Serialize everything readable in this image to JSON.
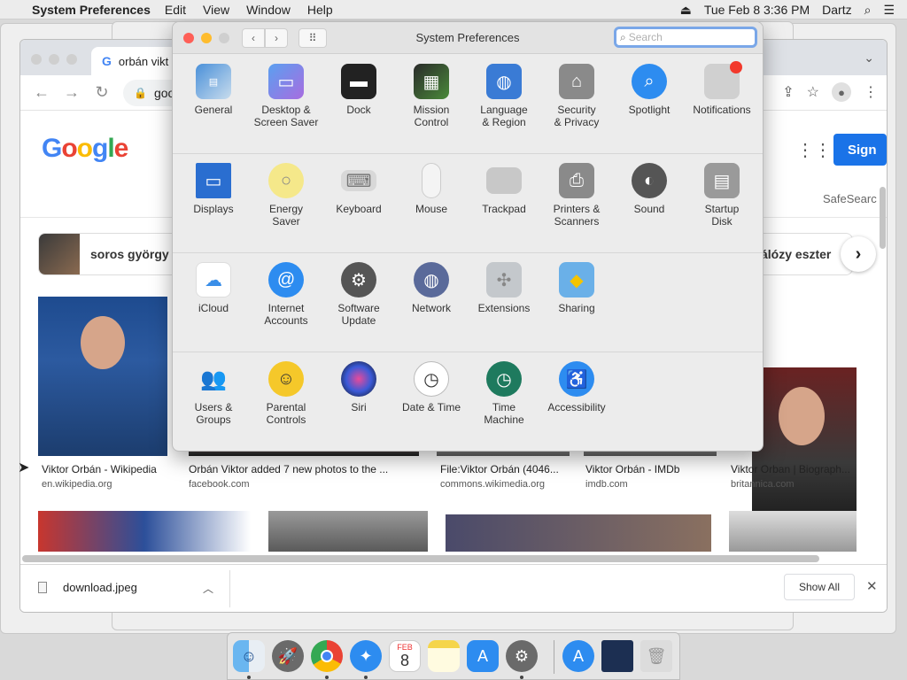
{
  "menubar": {
    "app": "System Preferences",
    "items": [
      "Edit",
      "View",
      "Window",
      "Help"
    ],
    "datetime": "Tue Feb 8  3:36 PM",
    "user": "Dartz"
  },
  "chrome": {
    "tab_title": "orbán vikt",
    "url": "goog",
    "google_logo": "Google",
    "signin": "Sign",
    "safesearch": "SafeSearc",
    "chips": [
      "soros györgy",
      "álózy eszter"
    ],
    "results": [
      {
        "title": "Viktor Orbán - Wikipedia",
        "source": "en.wikipedia.org"
      },
      {
        "title": "Orbán Viktor added 7 new photos to the ...",
        "source": "facebook.com"
      },
      {
        "title": "File:Viktor Orbán (4046...",
        "source": "commons.wikimedia.org"
      },
      {
        "title": "Viktor Orbán - IMDb",
        "source": "imdb.com"
      },
      {
        "title": "Viktor Orban | Biograph...",
        "source": "britannica.com"
      }
    ],
    "download": {
      "filename": "download.jpeg",
      "show_all": "Show All"
    }
  },
  "syspref": {
    "title": "System Preferences",
    "search_placeholder": "Search",
    "rows": [
      [
        {
          "label": "General",
          "icon": "general-icon"
        },
        {
          "label": "Desktop &\nScreen Saver",
          "icon": "desktop-icon"
        },
        {
          "label": "Dock",
          "icon": "dock-icon"
        },
        {
          "label": "Mission\nControl",
          "icon": "mission-control-icon"
        },
        {
          "label": "Language\n& Region",
          "icon": "globe-icon"
        },
        {
          "label": "Security\n& Privacy",
          "icon": "house-lock-icon"
        },
        {
          "label": "Spotlight",
          "icon": "magnifier-icon"
        },
        {
          "label": "Notifications",
          "icon": "notifications-icon"
        }
      ],
      [
        {
          "label": "Displays",
          "icon": "display-icon"
        },
        {
          "label": "Energy\nSaver",
          "icon": "bulb-icon"
        },
        {
          "label": "Keyboard",
          "icon": "keyboard-icon"
        },
        {
          "label": "Mouse",
          "icon": "mouse-icon"
        },
        {
          "label": "Trackpad",
          "icon": "trackpad-icon"
        },
        {
          "label": "Printers &\nScanners",
          "icon": "printer-icon"
        },
        {
          "label": "Sound",
          "icon": "speaker-icon"
        },
        {
          "label": "Startup\nDisk",
          "icon": "disk-icon"
        }
      ],
      [
        {
          "label": "iCloud",
          "icon": "cloud-icon"
        },
        {
          "label": "Internet\nAccounts",
          "icon": "at-icon"
        },
        {
          "label": "Software\nUpdate",
          "icon": "gear-icon"
        },
        {
          "label": "Network",
          "icon": "network-globe-icon"
        },
        {
          "label": "Extensions",
          "icon": "puzzle-icon"
        },
        {
          "label": "Sharing",
          "icon": "folder-sharing-icon"
        }
      ],
      [
        {
          "label": "Users &\nGroups",
          "icon": "users-icon"
        },
        {
          "label": "Parental\nControls",
          "icon": "parental-icon"
        },
        {
          "label": "Siri",
          "icon": "siri-icon"
        },
        {
          "label": "Date & Time",
          "icon": "clock-icon"
        },
        {
          "label": "Time\nMachine",
          "icon": "time-machine-icon"
        },
        {
          "label": "Accessibility",
          "icon": "accessibility-icon"
        }
      ]
    ]
  },
  "dock": {
    "calendar_month": "FEB",
    "calendar_day": "8"
  }
}
